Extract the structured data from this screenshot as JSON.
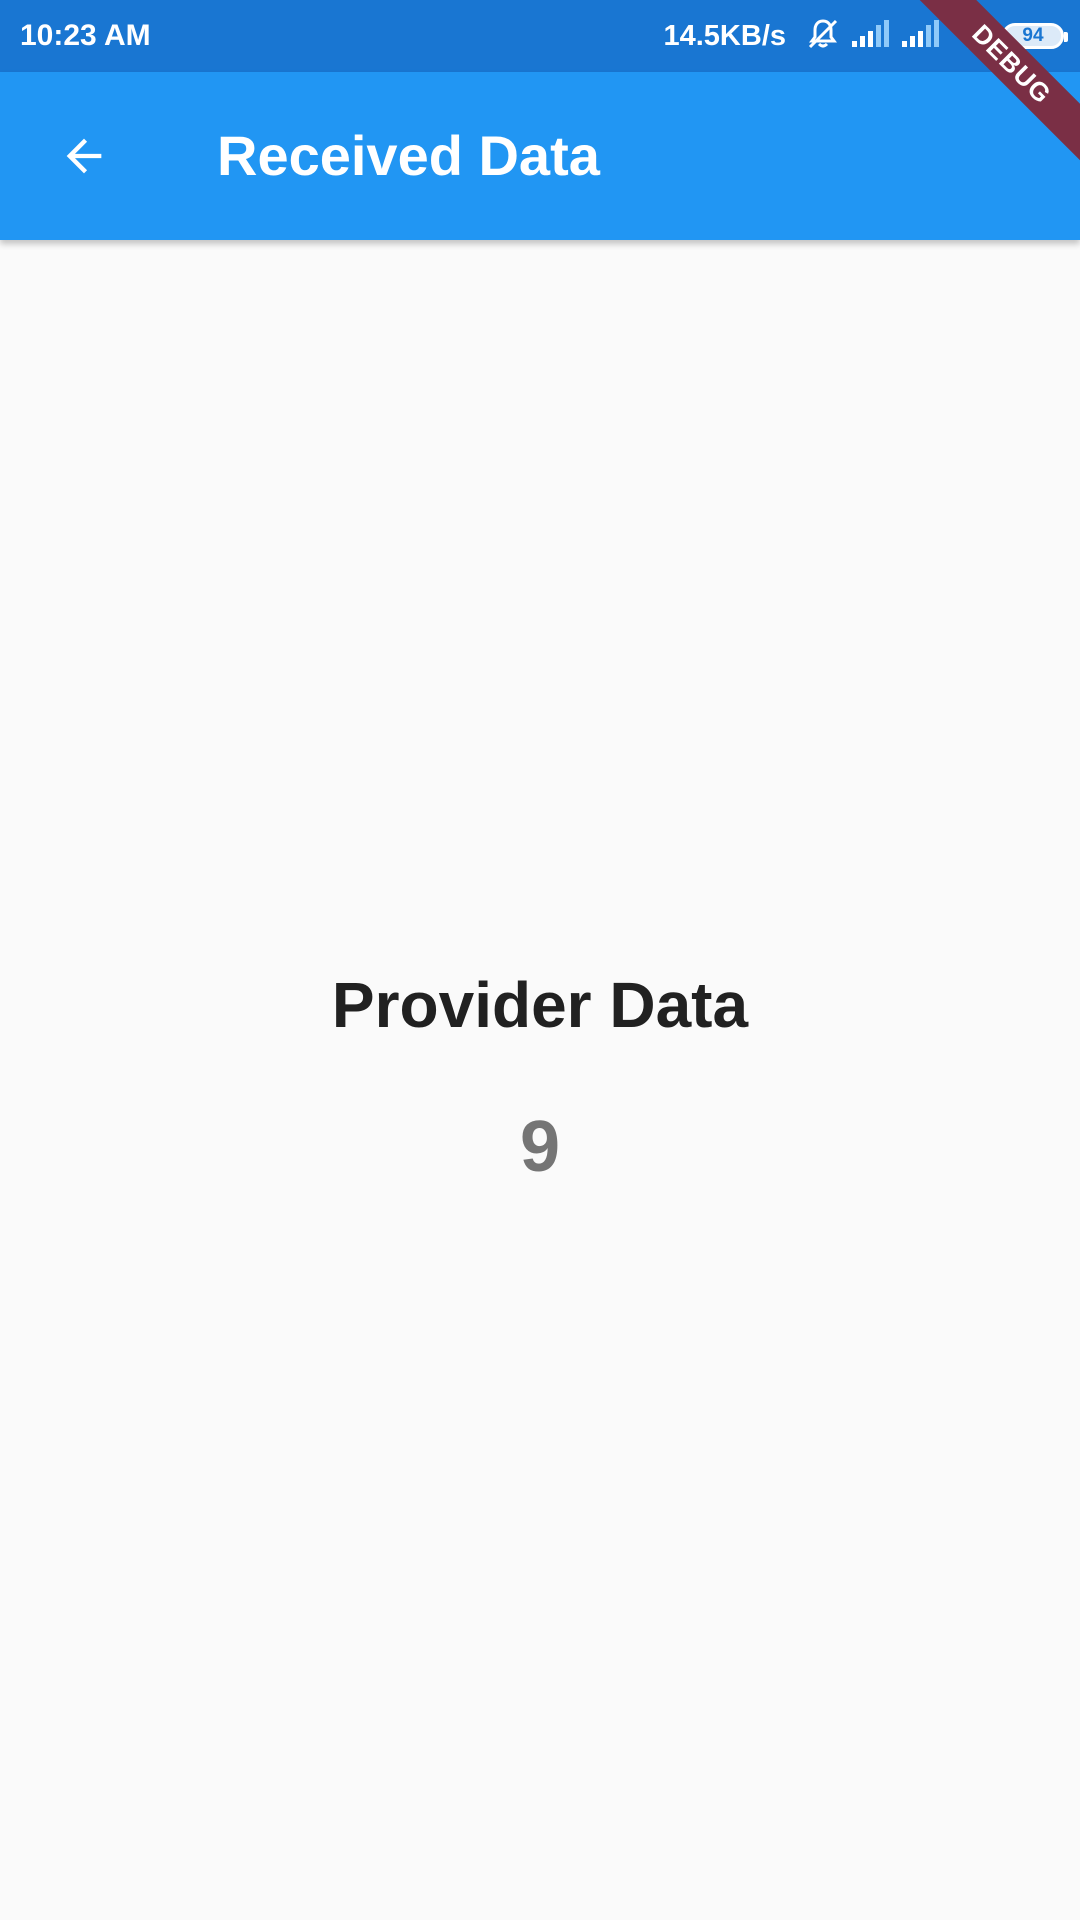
{
  "status_bar": {
    "time": "10:23 AM",
    "net_speed": "14.5KB/s",
    "battery": "94",
    "icons": [
      "mute-bell-icon",
      "signal-icon",
      "signal-icon",
      "wifi-icon",
      "battery-icon"
    ]
  },
  "app_bar": {
    "title": "Received Data",
    "back_icon": "arrow-back-icon",
    "color": "#2196f3"
  },
  "content": {
    "title": "Provider Data",
    "value": "9"
  },
  "debug_banner": "DEBUG"
}
